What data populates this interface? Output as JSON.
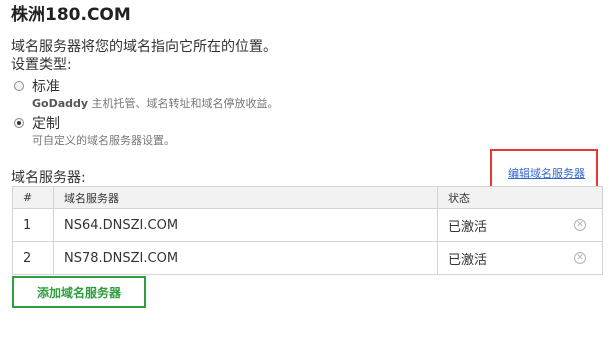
{
  "title": "株洲180.COM",
  "description": "域名服务器将您的域名指向它所在的位置。",
  "settings_type_label": "设置类型:",
  "options": [
    {
      "label": "标准",
      "sublabel_brand": "GoDaddy",
      "sublabel_rest": " 主机托管、域名转址和域名停放收益。",
      "selected": false
    },
    {
      "label": "定制",
      "sublabel": "可自定义的域名服务器设置。",
      "selected": true
    }
  ],
  "nameservers_label": "域名服务器:",
  "edit_link": "编辑域名服务器",
  "table": {
    "headers": [
      "#",
      "域名服务器",
      "状态"
    ],
    "rows": [
      {
        "num": "1",
        "server": "NS64.DNSZI.COM",
        "status": "已激活",
        "delete_icon": "close-circle-icon"
      },
      {
        "num": "2",
        "server": "NS78.DNSZI.COM",
        "status": "已激活",
        "delete_icon": "close-circle-icon"
      }
    ]
  },
  "add_button": "添加域名服务器",
  "colors": {
    "link": "#3366cc",
    "highlight_red": "#e53935",
    "highlight_green": "#2e9e3e",
    "header_bg": "#f2f2f2"
  }
}
